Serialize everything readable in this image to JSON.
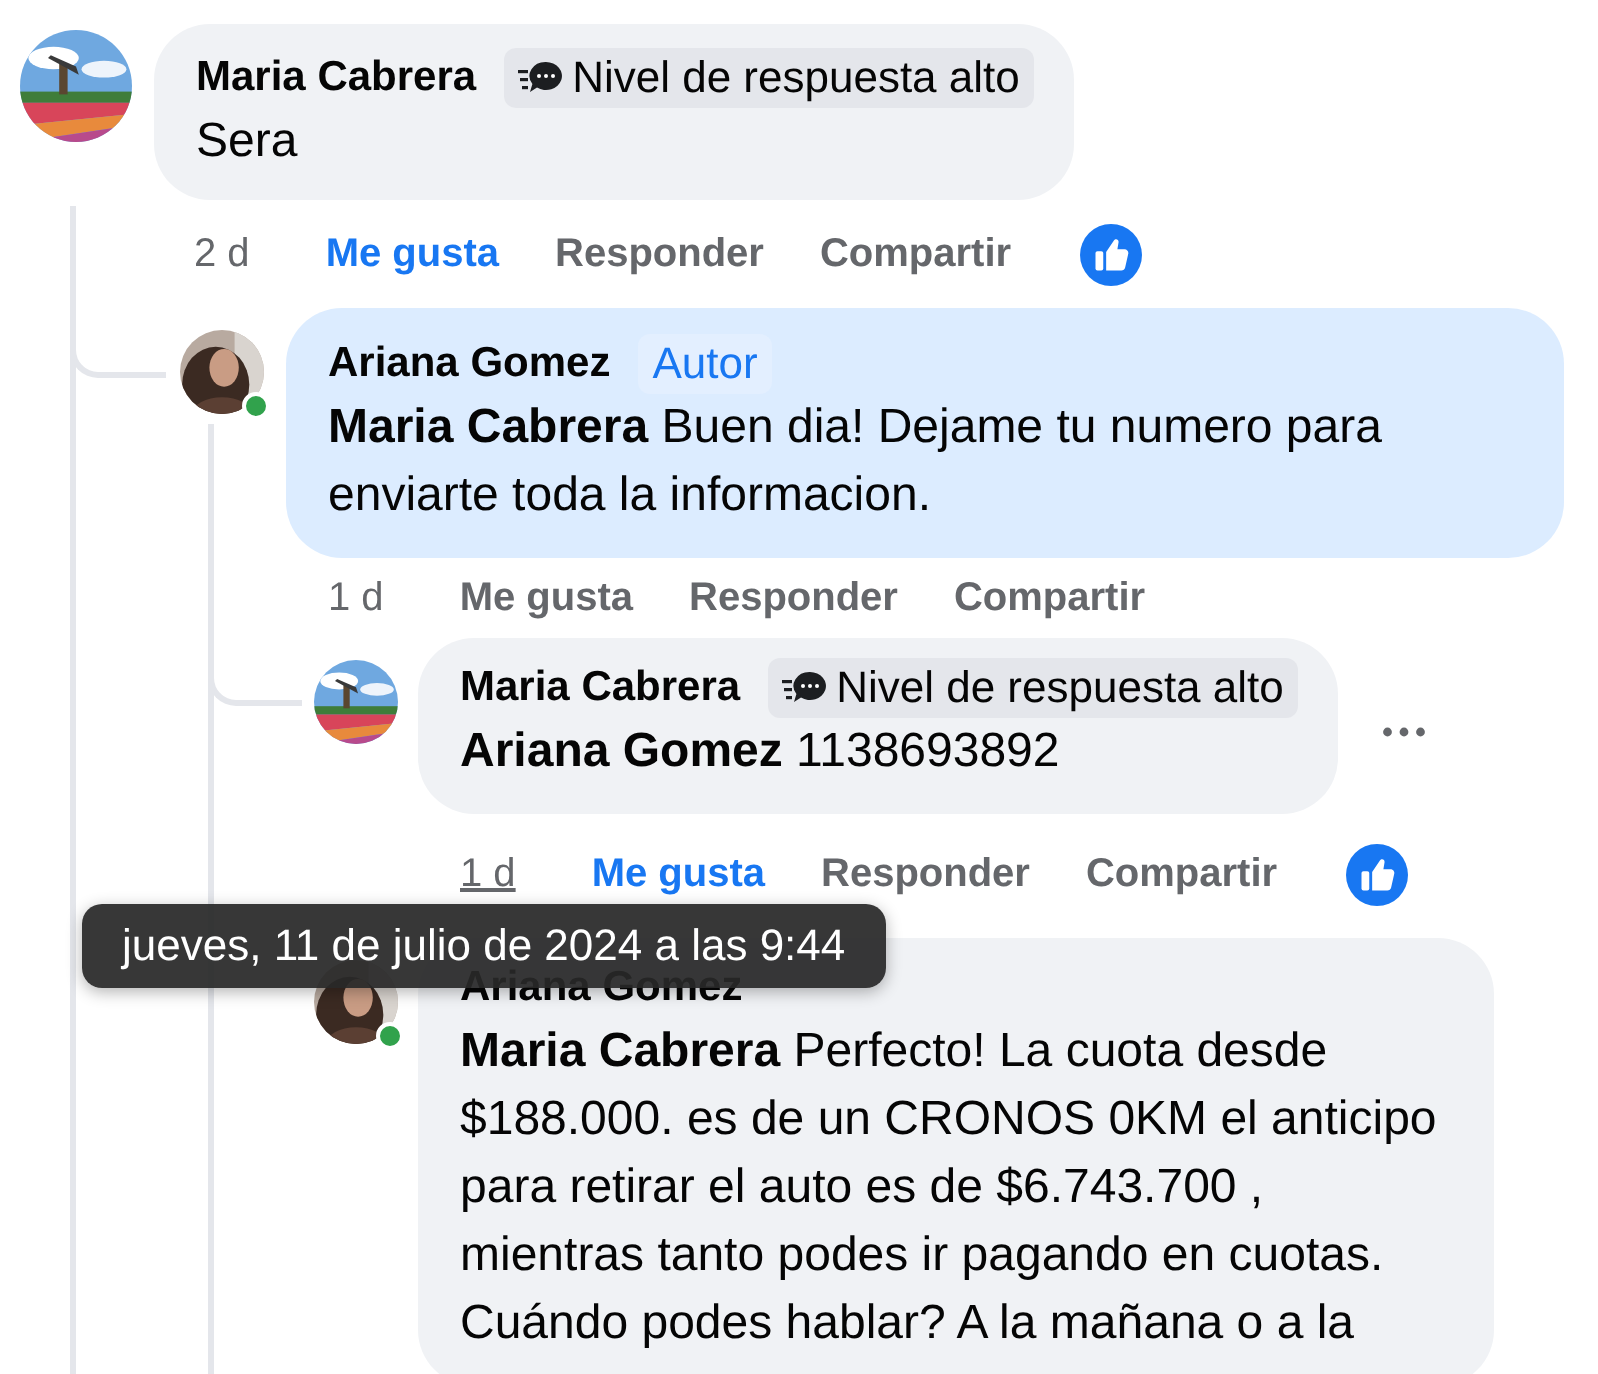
{
  "comments": [
    {
      "author": "Maria Cabrera",
      "avatar": {
        "kind": "landscape"
      },
      "badge": {
        "kind": "response",
        "label": "Nivel de respuesta alto"
      },
      "text": "Sera",
      "time": "2 d",
      "time_hovered": false,
      "like_label": "Me gusta",
      "liked": true,
      "reply_label": "Responder",
      "share_label": "Compartir",
      "reaction": true,
      "children": [
        {
          "author": "Ariana Gomez",
          "avatar": {
            "kind": "person"
          },
          "online": true,
          "badge": {
            "kind": "author",
            "label": "Autor"
          },
          "text": "**Maria Cabrera** Buen dia! Dejame tu numero para enviarte toda la informacion.",
          "time": "1 d",
          "time_hovered": false,
          "like_label": "Me gusta",
          "liked": false,
          "reply_label": "Responder",
          "share_label": "Compartir",
          "highlighted": true,
          "children": [
            {
              "author": "Maria Cabrera",
              "avatar": {
                "kind": "landscape"
              },
              "badge": {
                "kind": "response",
                "label": "Nivel de respuesta alto"
              },
              "text": "**Ariana Gomez** 1138693892",
              "time": "1 d",
              "time_hovered": true,
              "like_label": "Me gusta",
              "liked": true,
              "reply_label": "Responder",
              "share_label": "Compartir",
              "reaction": true,
              "more_menu": true
            },
            {
              "author": "Ariana Gomez",
              "avatar": {
                "kind": "person"
              },
              "online": true,
              "text": "**Maria Cabrera** Perfecto! La cuota desde $188.000. es de un CRONOS 0KM el anticipo para retirar el auto es de $6.743.700 , mientras tanto podes ir pagando en cuotas. Cuándo podes hablar? A la mañana o a la"
            }
          ]
        }
      ]
    }
  ],
  "tooltip": {
    "text": "jueves, 11 de julio de 2024 a las 9:44"
  }
}
